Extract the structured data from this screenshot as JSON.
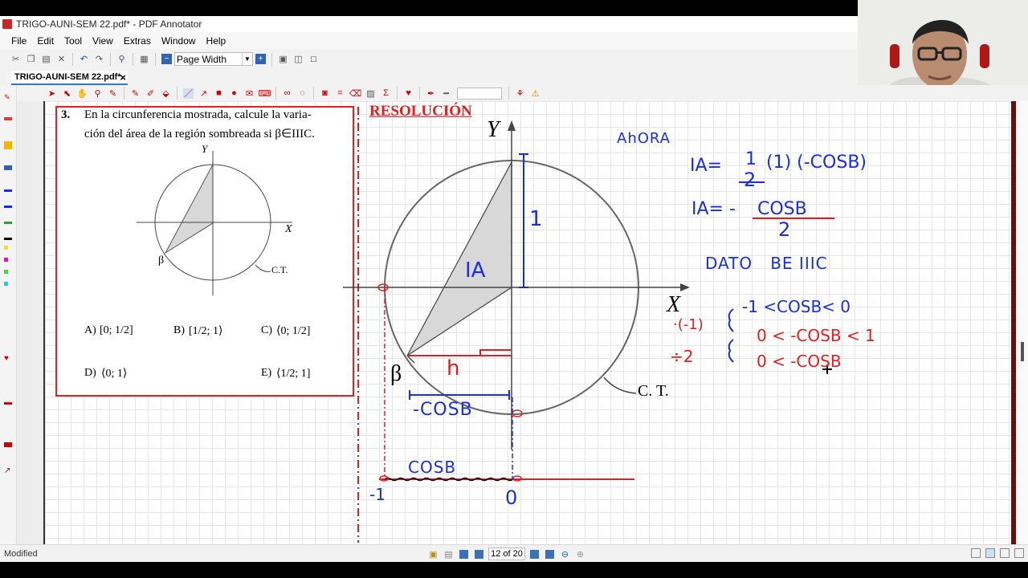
{
  "window": {
    "title": "TRIGO-AUNI-SEM 22.pdf* - PDF Annotator",
    "tab_label": "TRIGO-AUNI-SEM 22.pdf*",
    "tab_close": "×"
  },
  "menu": [
    "File",
    "Edit",
    "Tool",
    "View",
    "Extras",
    "Window",
    "Help"
  ],
  "toolbar": {
    "zoom_value": "Page Width"
  },
  "status": {
    "text": "Modified",
    "page_display": "12 of 20"
  },
  "problem": {
    "number": "3.",
    "text_line1": "En la circunferencia mostrada, calcule la varia-",
    "text_line2": "ción del área de la región sombreada si β∈IIIC.",
    "diagram": {
      "y_label": "Y",
      "x_label": "X",
      "beta_label": "β",
      "ct_label": "C.T."
    },
    "options": [
      {
        "key": "A)",
        "text": "[0; 1/2]"
      },
      {
        "key": "B)",
        "text": "[1/2; 1⟩"
      },
      {
        "key": "C)",
        "text": "⟨0; 1/2]"
      },
      {
        "key": "D)",
        "text": "⟨0; 1⟩"
      },
      {
        "key": "E)",
        "text": "⟨1/2; 1]"
      }
    ]
  },
  "resolution": {
    "heading": "RESOLUCIÓN",
    "y_label": "Y",
    "x_label": "X",
    "beta_label": "β",
    "ct_label": "C. T.",
    "area_label": "IA",
    "radius_label": "1",
    "h_label": "h",
    "neg_cos_label": "-COSB",
    "cos_label": "COSB",
    "minus_one_label": "-1",
    "zero_label": "0"
  },
  "notes": {
    "ahora": "AhORA",
    "eq1_lhs": "IA=",
    "eq1_num": "1",
    "eq1_den": "2",
    "eq1_rest": "(1) (-COSB)",
    "eq2_lhs": "IA= -",
    "eq2_num": "COSB",
    "eq2_den": "2",
    "dato": "DATO   BE IIIC",
    "ineq1": "-1 <COSB< 0",
    "ineq2_op": "·(-1)",
    "ineq2": "0 < -COSB < 1",
    "ineq3_op": "÷2",
    "ineq3": "0 < -COSB"
  },
  "colors": {
    "red": "#e02020",
    "blue": "#1a2ee0",
    "shade": "#d8d8d8",
    "accent": "#3477c8"
  }
}
